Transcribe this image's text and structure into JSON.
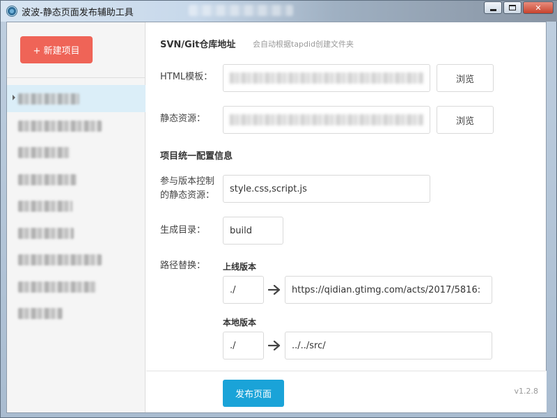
{
  "window": {
    "title": "波波-静态页面发布辅助工具",
    "controls": {
      "minimize": "",
      "maximize": "",
      "close": "✕"
    }
  },
  "sidebar": {
    "new_project_label": "+ 新建项目",
    "projects": [
      {
        "label": "",
        "active": true
      },
      {
        "label": "",
        "active": false
      },
      {
        "label": "",
        "active": false
      },
      {
        "label": "",
        "active": false
      },
      {
        "label": "",
        "active": false
      },
      {
        "label": "",
        "active": false
      },
      {
        "label": "",
        "active": false
      },
      {
        "label": "",
        "active": false
      },
      {
        "label": "",
        "active": false
      }
    ]
  },
  "repo": {
    "title": "SVN/Git仓库地址",
    "hint": "会自动根据tapdid创建文件夹",
    "html_template_label": "HTML模板：",
    "static_resource_label": "静态资源：",
    "browse_label": "浏览"
  },
  "config": {
    "title": "项目统一配置信息",
    "versioned_label_line1": "参与版本控制",
    "versioned_label_line2": "的静态资源：",
    "versioned_value": "style.css,script.js",
    "output_dir_label": "生成目录：",
    "output_dir_value": "build",
    "path_replace_label": "路径替换：",
    "online": {
      "title": "上线版本",
      "from": "./",
      "to": "https://qidian.gtimg.com/acts/2017/5816:"
    },
    "local": {
      "title": "本地版本",
      "from": "./",
      "to": "../../src/"
    }
  },
  "footer": {
    "publish_label": "发布页面",
    "version": "v1.2.8"
  }
}
